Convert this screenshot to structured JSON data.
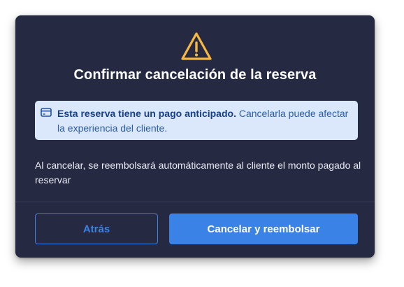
{
  "dialog": {
    "title": "Confirmar cancelación de la reserva",
    "icon": "warning-triangle-icon",
    "info": {
      "icon": "credit-card-icon",
      "bold": "Esta reserva tiene un pago anticipado.",
      "text": " Cancelarla puede afectar la experiencia del cliente."
    },
    "description": "Al cancelar, se reembolsará automáticamente al cliente el monto pagado al reservar",
    "buttons": {
      "back": "Atrás",
      "confirm": "Cancelar y reembolsar"
    }
  },
  "colors": {
    "background": "#252a42",
    "accent": "#3b82e6",
    "warning": "#f5b942",
    "info_bg": "#dbe8fb"
  }
}
